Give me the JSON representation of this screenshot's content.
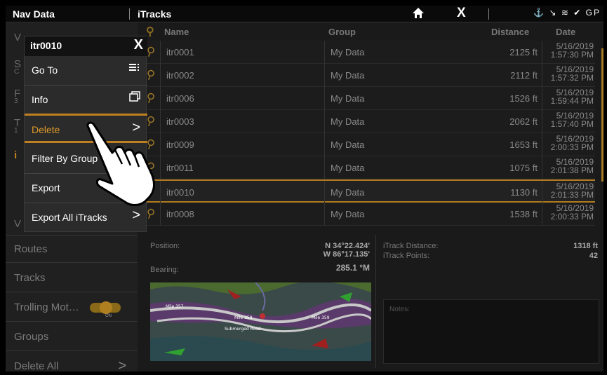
{
  "topbar": {
    "left_title": "Nav Data",
    "mid_title": "iTracks",
    "home_icon": "home-icon",
    "close_label": "X",
    "status_icons": "⚓ ↘ ≋ ✔ GP"
  },
  "leftnav": {
    "items": [
      {
        "label": "Routes"
      },
      {
        "label": "Tracks"
      },
      {
        "label": "Trolling Mot…",
        "toggle": "ON"
      },
      {
        "label": "Groups"
      },
      {
        "label": "Delete All",
        "chevron": ">"
      }
    ],
    "partial": [
      "V",
      "S",
      "C",
      "F",
      "3",
      "T",
      "1",
      "i",
      "V"
    ]
  },
  "table": {
    "headers": {
      "name": "Name",
      "group": "Group",
      "distance": "Distance",
      "date": "Date"
    },
    "rows": [
      {
        "name": "itr0001",
        "group": "My Data",
        "distance": "2125 ft",
        "date1": "5/16/2019",
        "date2": "1:57:30 PM"
      },
      {
        "name": "itr0002",
        "group": "My Data",
        "distance": "2112 ft",
        "date1": "5/16/2019",
        "date2": "1:57:32 PM"
      },
      {
        "name": "itr0006",
        "group": "My Data",
        "distance": "1526 ft",
        "date1": "5/16/2019",
        "date2": "1:59:44 PM"
      },
      {
        "name": "itr0003",
        "group": "My Data",
        "distance": "2062 ft",
        "date1": "5/16/2019",
        "date2": "1:57:40 PM"
      },
      {
        "name": "itr0009",
        "group": "My Data",
        "distance": "1653 ft",
        "date1": "5/16/2019",
        "date2": "2:00:33 PM"
      },
      {
        "name": "itr0011",
        "group": "My Data",
        "distance": "1075 ft",
        "date1": "5/16/2019",
        "date2": "2:01:38 PM"
      },
      {
        "name": "itr0010",
        "group": "My Data",
        "distance": "1130 ft",
        "date1": "5/16/2019",
        "date2": "2:01:33 PM"
      },
      {
        "name": "itr0008",
        "group": "My Data",
        "distance": "1538 ft",
        "date1": "5/16/2019",
        "date2": "2:00:33 PM"
      }
    ],
    "selected_index": 6
  },
  "details": {
    "position_label": "Position:",
    "position_lat": "N 34°22.424'",
    "position_lon": "W 86°17.135'",
    "bearing_label": "Bearing:",
    "bearing_value": "285.1 °M",
    "distance_label": "iTrack Distance:",
    "distance_value": "1318 ft",
    "points_label": "iTrack Points:",
    "points_value": "42",
    "notes_label": "Notes:",
    "map_labels": [
      "Mile 357",
      "Mile 358",
      "Mile 359",
      "Submerged Road"
    ]
  },
  "menu": {
    "title": "itr0010",
    "close": "X",
    "items": [
      {
        "label": "Go To",
        "icon": "list-icon"
      },
      {
        "label": "Info",
        "icon": "windows-icon"
      },
      {
        "label": "Delete",
        "icon": "chevron-right-icon"
      },
      {
        "label": "Filter By Group"
      },
      {
        "label": "Export"
      },
      {
        "label": "Export All iTracks",
        "icon": "chevron-right-icon"
      }
    ]
  },
  "colors": {
    "accent": "#c08020",
    "background": "#1a1a1a",
    "menu": "#2b2b2b"
  }
}
